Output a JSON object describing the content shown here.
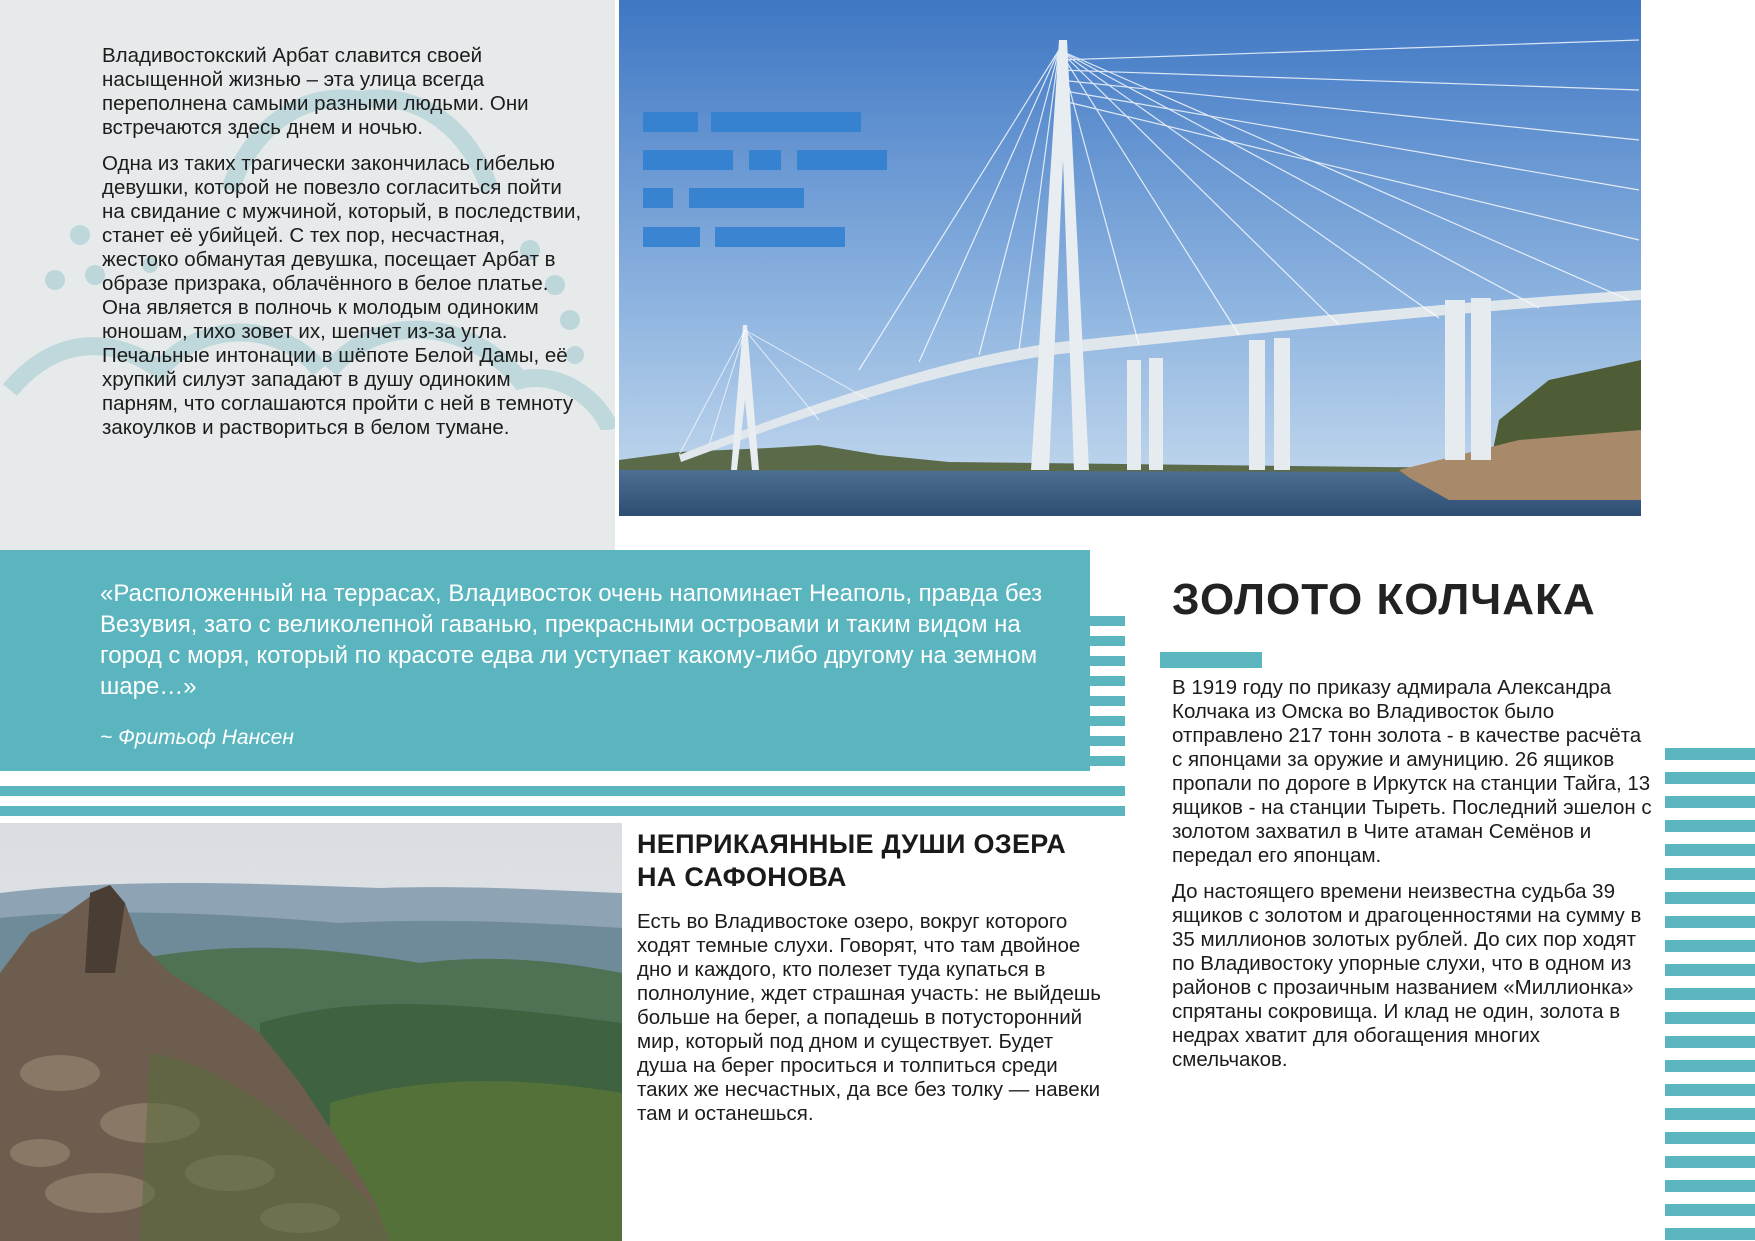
{
  "arbat": {
    "paragraphs": [
      "Владивостокский Арбат славится своей насыщенной жизнью – эта улица всегда переполнена самыми разными людьми. Они встречаются здесь днем и ночью.",
      "Одна из таких трагически закончилась гибелью девушки, которой не повезло согласиться пойти на свидание с мужчиной, который, в последствии, станет её убийцей. С тех пор, несчастная, жестоко обманутая девушка, посещает Арбат в образе призрака, облачённого в белое платье. Она является в полночь к молодым одиноким юношам, тихо зовет их, шепчет из-за угла. Печальные интонации в шёпоте Белой Дамы, её хрупкий силуэт западают в душу одиноким парням, что соглашаются пройти с ней в темноту закоулков и раствориться в белом тумане."
    ]
  },
  "quote": {
    "text": "«Расположенный на террасах, Владивосток очень напоминает Неаполь, правда без Везувия, зато с великолепной гаванью, прекрасными островами и таким видом на город с моря, который по красоте едва ли уступает какому-либо другому на земном шаре…»",
    "author": "~ Фритьоф Нансен"
  },
  "lake": {
    "title": "НЕПРИКАЯННЫЕ ДУШИ ОЗЕРА НА САФОНОВА",
    "text": "Есть во Владивостоке озеро, вокруг которого ходят темные слухи. Говорят, что там двойное дно и каждого, кто полезет туда купаться в полнолуние, ждет страшная участь: не выйдешь больше на берег, а попадешь в потусторонний мир, который под дном и существует. Будет душа на берег проситься и толпиться среди таких же несчастных, да все без толку — навеки там и останешься."
  },
  "kolchak": {
    "title": "ЗОЛОТО КОЛЧАКА",
    "paragraphs": [
      "В 1919 году по приказу адмирала Александра Колчака из Омска во Владивосток было отправлено 217 тонн золота - в качестве расчёта с японцами за оружие и амуницию. 26 ящиков пропали по дороге в Иркутск на станции Тайга, 13 ящиков - на станции Тыреть. Последний эшелон с золотом захватил в Чите атаман Семёнов и передал его японцам.",
      "До настоящего времени неизвестна судьба 39 ящиков с золотом и драгоценностями на сумму в 35 миллионов золотых рублей. До сих пор ходят по Владивостоку упорные слухи, что в одном из районов с прозаичным названием «Миллионка» спрятаны сокровища. И клад не один, золота в недрах хватит для обогащения многих смельчаков."
    ]
  },
  "colors": {
    "accent": "#5ab5bf",
    "panel": "#e6eaea"
  }
}
